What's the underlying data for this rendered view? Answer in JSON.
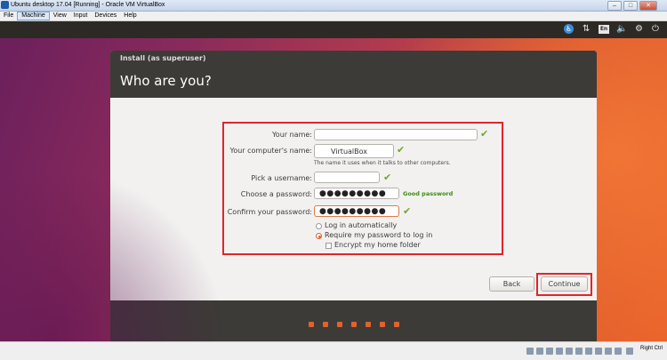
{
  "window": {
    "title": "Ubuntu desktop 17.04 [Running] - Oracle VM VirtualBox",
    "controls": {
      "minimize": "–",
      "maximize": "□",
      "close": "✕"
    }
  },
  "menubar": {
    "items": [
      "File",
      "Machine",
      "View",
      "Input",
      "Devices",
      "Help"
    ]
  },
  "tray": {
    "icons": [
      "accessibility-icon",
      "network-icon",
      "keyboard-layout-icon",
      "volume-icon",
      "settings-icon",
      "power-icon"
    ],
    "accessibility_glyph": "♿",
    "network_glyph": "⇅",
    "lang": "En",
    "volume_glyph": "🔈",
    "settings_glyph": "⚙",
    "power_glyph": "⏻"
  },
  "installer": {
    "subtitle": "Install (as superuser)",
    "title": "Who are you?",
    "fields": {
      "your_name_label": "Your name:",
      "your_name_value": "",
      "computer_name_label": "Your computer's name:",
      "computer_name_value": "VirtualBox",
      "computer_name_hint": "The name it uses when it talks to other computers.",
      "username_label": "Pick a username:",
      "username_value": "",
      "password_label": "Choose a password:",
      "password_value": "●●●●●●●●●",
      "password_strength": "Good password",
      "confirm_label": "Confirm your password:",
      "confirm_value": "●●●●●●●●●"
    },
    "check_glyph": "✔",
    "options": {
      "login_auto": "Log in automatically",
      "require_password": "Require my password to log in",
      "encrypt_home": "Encrypt my home folder",
      "selected": "require_password"
    },
    "buttons": {
      "back": "Back",
      "continue": "Continue"
    },
    "progress": {
      "steps_total": 7,
      "accent": "#e2622c"
    }
  },
  "statusbar": {
    "host_key": "Right Ctrl"
  },
  "colors": {
    "highlight_box": "#e0252b",
    "ubuntu_orange": "#e0602a",
    "dialog_dark": "#3c3b37",
    "check_green": "#6cab22"
  }
}
